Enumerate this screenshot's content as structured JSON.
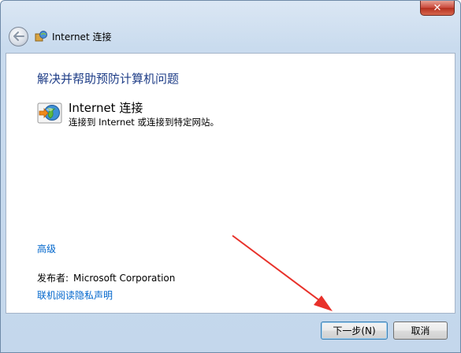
{
  "window": {
    "title": "Internet 连接",
    "close_symbol": "✕"
  },
  "main": {
    "heading": "解决并帮助预防计算机问题",
    "item": {
      "title": "Internet 连接",
      "description": "连接到 Internet 或连接到特定网站。",
      "icon": "internet-globe-icon"
    },
    "advanced_link": "高级",
    "publisher_label": "发布者:",
    "publisher_value": "Microsoft Corporation",
    "privacy_link": "联机阅读隐私声明"
  },
  "buttons": {
    "next_label": "下一步(N)",
    "cancel_label": "取消"
  },
  "colors": {
    "heading": "#1e3d87",
    "link": "#0066cc",
    "annotation_arrow": "#e8312a"
  }
}
